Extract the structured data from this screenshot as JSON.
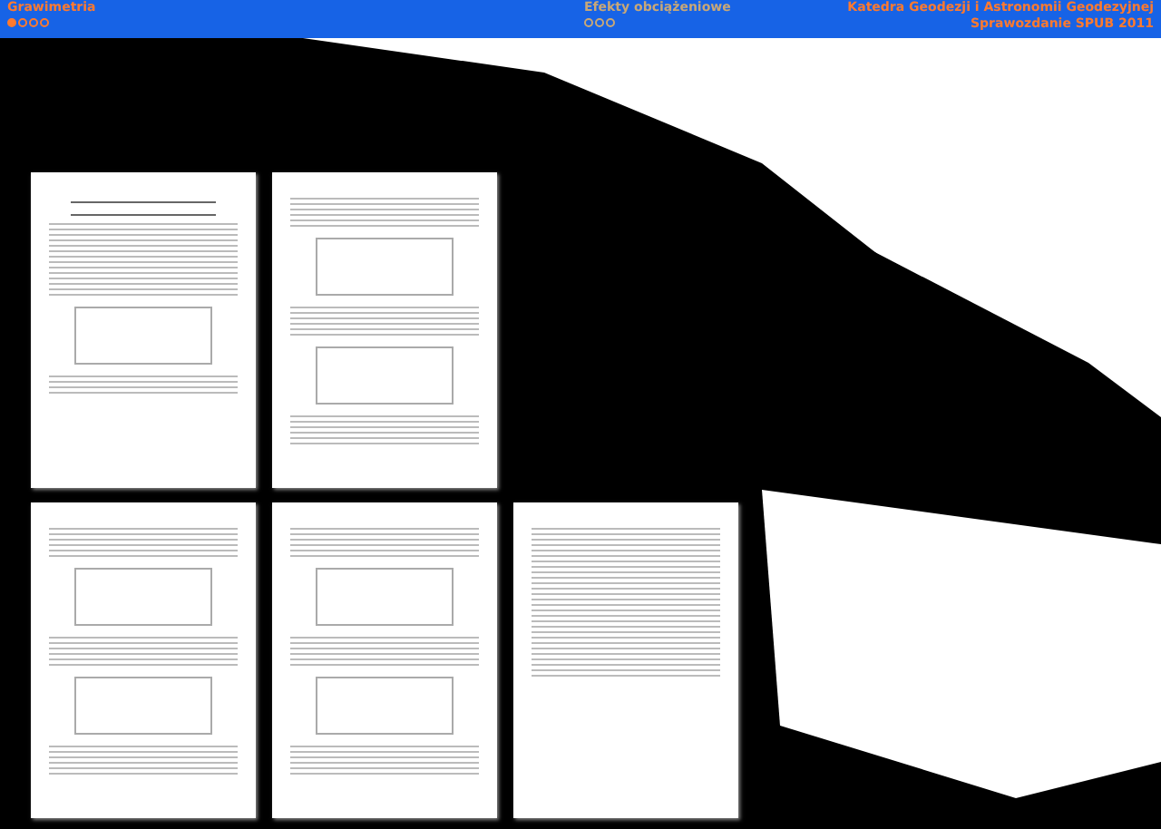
{
  "header": {
    "sections": [
      {
        "title": "Grawimetria",
        "active": true,
        "dots": [
          {
            "selected": true
          },
          {
            "selected": false
          },
          {
            "selected": false
          },
          {
            "selected": false
          }
        ]
      },
      {
        "title": "Efekty obciążeniowe",
        "active": false,
        "dots": [
          {
            "selected": false
          },
          {
            "selected": false
          },
          {
            "selected": false
          }
        ]
      }
    ],
    "institution": "Katedra Geodezji i Astronomii Geodezyjnej",
    "report": "Sprawozdanie SPUB 2011"
  },
  "pages": [
    {
      "kind": "title"
    },
    {
      "kind": "charts"
    },
    {
      "kind": "charts"
    },
    {
      "kind": "charts"
    },
    {
      "kind": "references"
    }
  ]
}
